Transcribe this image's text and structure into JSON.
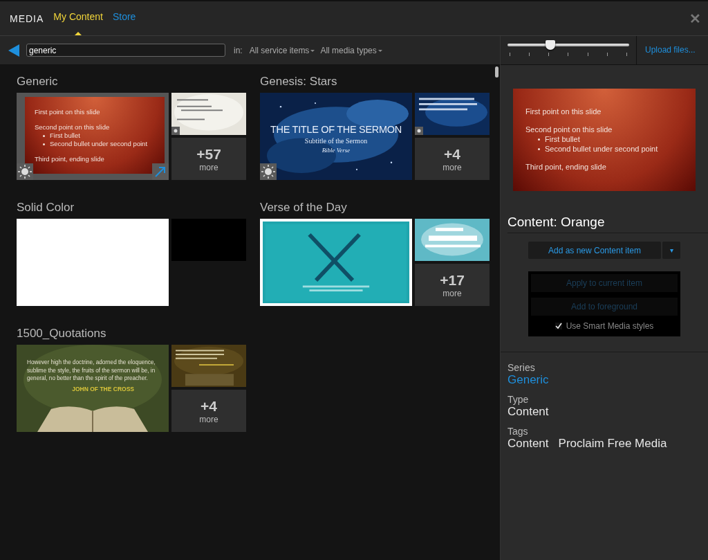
{
  "header": {
    "brand": "MEDIA",
    "tabs": [
      {
        "label": "My Content",
        "selected": true
      },
      {
        "label": "Store",
        "selected": false
      }
    ],
    "close": "✕"
  },
  "toolbar": {
    "search": {
      "value": "generic"
    },
    "in_label": "in:",
    "filters": [
      "All service items",
      "All media types"
    ],
    "zoom_slider": {
      "level": 0.35
    },
    "upload": "Upload files..."
  },
  "groups": [
    {
      "title": "Generic",
      "main": {
        "kind": "slide",
        "selected": true,
        "light_icon": true,
        "link_icon": true,
        "points": [
          {
            "text": "First point on this slide"
          },
          {
            "text": "Second point on this slide",
            "bullets": [
              "First bullet",
              "Second bullet under second point"
            ]
          },
          {
            "text": "Third point, ending slide"
          }
        ]
      },
      "thumb": {
        "kind": "picture",
        "light_icon": true
      },
      "more": {
        "count": "+57",
        "label": "more"
      }
    },
    {
      "title": "Genesis: Stars",
      "main": {
        "kind": "title_picture",
        "selected": false,
        "light_icon": true,
        "title": "THE TITLE OF THE SERMON",
        "subtitle": "Subtitle of the Sermon",
        "verse": "Bible Verse"
      },
      "thumb": {
        "kind": "picture",
        "light_icon": true
      },
      "more": {
        "count": "+4",
        "label": "more"
      }
    },
    {
      "title": "Solid Color",
      "main": {
        "kind": "color",
        "color": "#ffffff",
        "selected": false
      },
      "thumb": {
        "kind": "color",
        "color": "#000000"
      }
    },
    {
      "title": "Verse of the Day",
      "main": {
        "kind": "picture",
        "selected": false,
        "hovered": true
      },
      "thumb": {
        "kind": "picture"
      },
      "more": {
        "count": "+17",
        "label": "more"
      }
    },
    {
      "title": "1500_Quotations",
      "main": {
        "kind": "quote_picture",
        "selected": false,
        "quote": "However high the doctrine, adorned the eloquence, sublime the style, the fruits of the sermon will be, in general, no better than the spirit of the preacher.",
        "author": "JOHN OF THE CROSS"
      },
      "thumb": {
        "kind": "picture"
      },
      "more": {
        "count": "+4",
        "label": "more"
      }
    }
  ],
  "preview": {
    "points": [
      {
        "text": "First point on this slide"
      },
      {
        "text": "Second point on this slide",
        "bullets": [
          "First bullet",
          "Second bullet under second point"
        ]
      },
      {
        "text": "Third point, ending slide"
      }
    ],
    "title": "Content: Orange"
  },
  "actions": {
    "primary": "Add as new Content item",
    "menu_caret": "▾",
    "buttons": [
      {
        "label": "Apply to current item",
        "disabled": true
      },
      {
        "label": "Add to foreground",
        "disabled": true
      }
    ],
    "smart_styles": {
      "label": "Use Smart Media styles",
      "checked": true
    }
  },
  "details": [
    {
      "label": "Series",
      "values": [
        "Generic"
      ],
      "link": true
    },
    {
      "label": "Type",
      "values": [
        "Content"
      ],
      "link": false
    },
    {
      "label": "Tags",
      "values": [
        "Content",
        "Proclaim Free Media"
      ],
      "link": false
    }
  ]
}
